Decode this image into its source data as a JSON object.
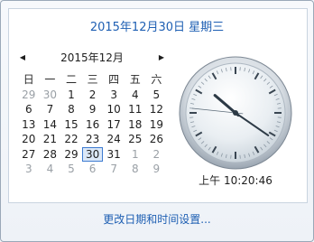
{
  "header": {
    "date_link": "2015年12月30日 星期三"
  },
  "calendar": {
    "month_title": "2015年12月",
    "prev_icon": "triangle-left-icon",
    "next_icon": "triangle-right-icon",
    "weekdays": [
      "日",
      "一",
      "二",
      "三",
      "四",
      "五",
      "六"
    ],
    "weeks": [
      [
        {
          "d": "29",
          "other": true
        },
        {
          "d": "30",
          "other": true
        },
        {
          "d": "1"
        },
        {
          "d": "2"
        },
        {
          "d": "3"
        },
        {
          "d": "4"
        },
        {
          "d": "5"
        }
      ],
      [
        {
          "d": "6"
        },
        {
          "d": "7"
        },
        {
          "d": "8"
        },
        {
          "d": "9"
        },
        {
          "d": "10"
        },
        {
          "d": "11"
        },
        {
          "d": "12"
        }
      ],
      [
        {
          "d": "13"
        },
        {
          "d": "14"
        },
        {
          "d": "15"
        },
        {
          "d": "16"
        },
        {
          "d": "17"
        },
        {
          "d": "18"
        },
        {
          "d": "19"
        }
      ],
      [
        {
          "d": "20"
        },
        {
          "d": "21"
        },
        {
          "d": "22"
        },
        {
          "d": "23"
        },
        {
          "d": "24"
        },
        {
          "d": "25"
        },
        {
          "d": "26"
        }
      ],
      [
        {
          "d": "27"
        },
        {
          "d": "28"
        },
        {
          "d": "29"
        },
        {
          "d": "30",
          "selected": true
        },
        {
          "d": "31"
        },
        {
          "d": "1",
          "other": true
        },
        {
          "d": "2",
          "other": true
        }
      ],
      [
        {
          "d": "3",
          "other": true
        },
        {
          "d": "4",
          "other": true
        },
        {
          "d": "5",
          "other": true
        },
        {
          "d": "6",
          "other": true
        },
        {
          "d": "7",
          "other": true
        },
        {
          "d": "8",
          "other": true
        },
        {
          "d": "9",
          "other": true
        }
      ]
    ]
  },
  "clock": {
    "time_text": "上午 10:20:46",
    "hour": 10,
    "minute": 20,
    "second": 46
  },
  "footer": {
    "change_link": "更改日期和时间设置..."
  },
  "colors": {
    "link": "#1e5fb3",
    "selected_border": "#3d7bd1",
    "other_month": "#9aa0a6"
  }
}
